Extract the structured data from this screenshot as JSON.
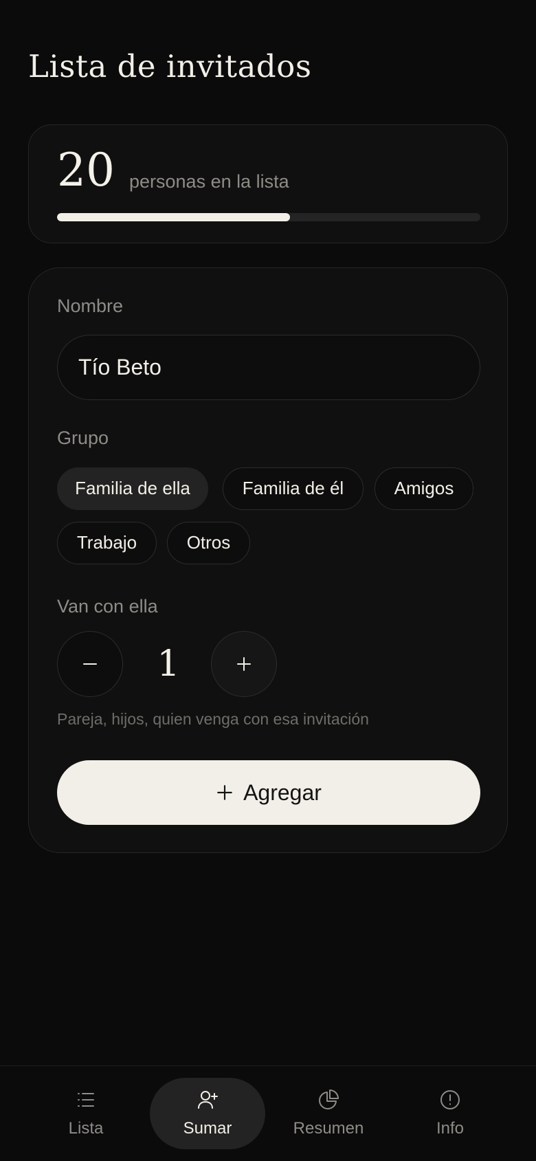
{
  "header": {
    "title": "Lista de invitados"
  },
  "stats": {
    "count": "20",
    "count_label": "personas en la lista",
    "progress_fraction": 0.55
  },
  "form": {
    "name_label": "Nombre",
    "name_value": "Tío Beto",
    "group_label": "Grupo",
    "groups": [
      {
        "label": "Familia de ella",
        "selected": true
      },
      {
        "label": "Familia de él",
        "selected": false
      },
      {
        "label": "Amigos",
        "selected": false
      },
      {
        "label": "Trabajo",
        "selected": false
      },
      {
        "label": "Otros",
        "selected": false
      }
    ],
    "companions_label": "Van con ella",
    "companions_value": "1",
    "companions_hint": "Pareja, hijos, quien venga con esa invitación",
    "submit_label": "Agregar",
    "submit_icon": "plus-icon"
  },
  "nav": {
    "items": [
      {
        "label": "Lista",
        "icon": "list-icon",
        "active": false
      },
      {
        "label": "Sumar",
        "icon": "user-plus-icon",
        "active": true
      },
      {
        "label": "Resumen",
        "icon": "pie-chart-icon",
        "active": false
      },
      {
        "label": "Info",
        "icon": "info-icon",
        "active": false
      }
    ]
  },
  "colors": {
    "background": "#0b0b0b",
    "card": "#101010",
    "accent": "#f2efe8",
    "muted_text": "#8e8c87"
  }
}
